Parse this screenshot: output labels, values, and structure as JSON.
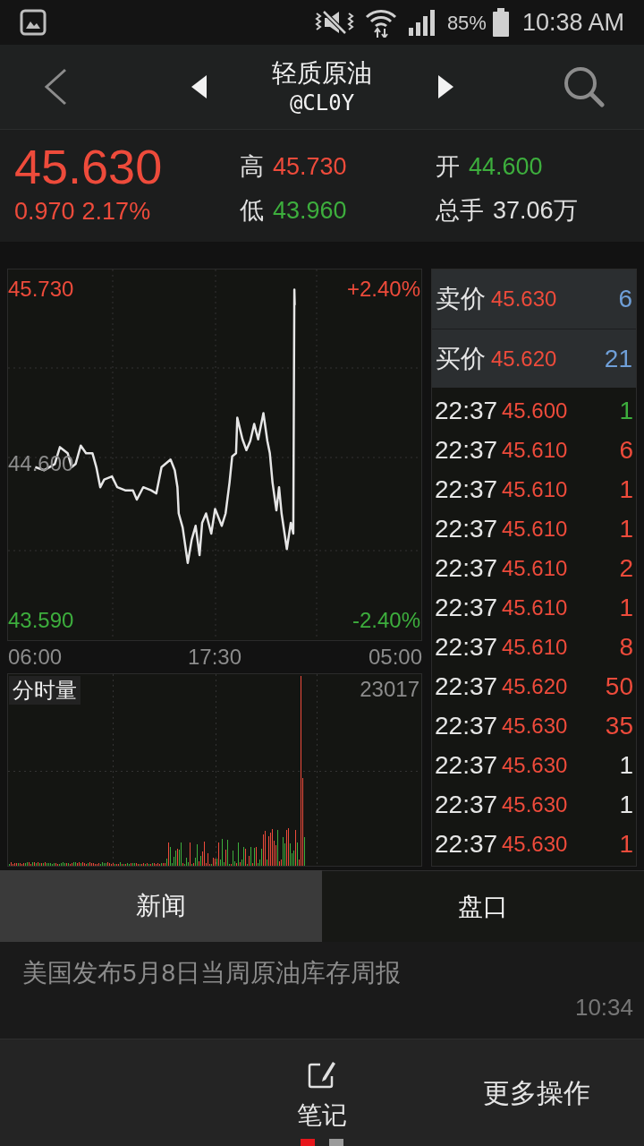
{
  "status_bar": {
    "battery": "85%",
    "time": "10:38 AM"
  },
  "header": {
    "title": "轻质原油",
    "symbol": "@CL0Y"
  },
  "quote": {
    "price": "45.630",
    "change": "0.970",
    "change_percent": "2.17%",
    "stats": [
      {
        "label": "高",
        "value": "45.730",
        "color": "#ee4b3b"
      },
      {
        "label": "开",
        "value": "44.600",
        "color": "#3dae3d"
      },
      {
        "label": "低",
        "value": "43.960",
        "color": "#3dae3d"
      },
      {
        "label": "总手",
        "value": "37.06万",
        "color": "#e0e0e0"
      }
    ]
  },
  "price_chart": {
    "range_labels": {
      "upper": "+2.40%",
      "lower": "-2.40%"
    },
    "session_end_label": "05:00",
    "chart_data": {
      "type": "line",
      "x": [
        6.02,
        6.6,
        7.27,
        7.6,
        8.1,
        8.35,
        8.6,
        8.93,
        9.27,
        9.68,
        9.93,
        10.18,
        10.43,
        10.93,
        11.27,
        11.77,
        12.27,
        12.52,
        12.93,
        13.43,
        13.77,
        14.1,
        14.68,
        14.95,
        15.12,
        15.2,
        15.45,
        15.78,
        16.03,
        16.28,
        16.53,
        16.7,
        16.95,
        17.28,
        17.53,
        17.95,
        18.2,
        18.45,
        18.62,
        18.87,
        18.95,
        19.28,
        19.53,
        19.78,
        20.03,
        20.28,
        20.62,
        20.87,
        21.03,
        21.2,
        21.45,
        21.62,
        21.78,
        22.12,
        22.37,
        22.53,
        22.6,
        22.62
      ],
      "series": [
        {
          "color": "#e6e6e6",
          "values": [
            44.58,
            44.56,
            44.6,
            44.71,
            44.67,
            44.58,
            44.6,
            44.72,
            44.67,
            44.67,
            44.58,
            44.45,
            44.5,
            44.52,
            44.45,
            44.43,
            44.43,
            44.37,
            44.45,
            44.43,
            44.41,
            44.58,
            44.63,
            44.56,
            44.45,
            44.28,
            44.19,
            43.96,
            44.11,
            44.2,
            44.01,
            44.22,
            44.28,
            44.15,
            44.31,
            44.2,
            44.28,
            44.48,
            44.65,
            44.67,
            44.9,
            44.76,
            44.69,
            44.75,
            44.86,
            44.76,
            44.93,
            44.75,
            44.67,
            44.48,
            44.3,
            44.45,
            44.28,
            44.05,
            44.22,
            44.15,
            45.73,
            45.63
          ]
        }
      ],
      "xlim": [
        4.28,
        30.72
      ],
      "ylim": [
        43.46,
        45.86
      ],
      "xticks": [
        {
          "value": 6,
          "label": "06:00"
        },
        {
          "value": 17.5,
          "label": "17:30"
        }
      ],
      "yticks": [
        {
          "value": 43.59,
          "label": "43.590"
        },
        {
          "value": 44.6,
          "label": "44.600"
        },
        {
          "value": 45.73,
          "label": "45.730"
        }
      ]
    }
  },
  "volume_chart": {
    "title": "分时量",
    "max_label": "23017"
  },
  "order_book": {
    "quotes": [
      {
        "label": "卖价",
        "price": "45.630",
        "size": "6"
      },
      {
        "label": "买价",
        "price": "45.620",
        "size": "21"
      }
    ],
    "trades": [
      {
        "time": "22:37",
        "price": "45.600",
        "volume": "1",
        "color": "#3dae3d"
      },
      {
        "time": "22:37",
        "price": "45.610",
        "volume": "6",
        "color": "#ee4b3b"
      },
      {
        "time": "22:37",
        "price": "45.610",
        "volume": "1",
        "color": "#ee4b3b"
      },
      {
        "time": "22:37",
        "price": "45.610",
        "volume": "1",
        "color": "#ee4b3b"
      },
      {
        "time": "22:37",
        "price": "45.610",
        "volume": "2",
        "color": "#ee4b3b"
      },
      {
        "time": "22:37",
        "price": "45.610",
        "volume": "1",
        "color": "#ee4b3b"
      },
      {
        "time": "22:37",
        "price": "45.610",
        "volume": "8",
        "color": "#ee4b3b"
      },
      {
        "time": "22:37",
        "price": "45.620",
        "volume": "50",
        "color": "#ee4b3b"
      },
      {
        "time": "22:37",
        "price": "45.630",
        "volume": "35",
        "color": "#ee4b3b"
      },
      {
        "time": "22:37",
        "price": "45.630",
        "volume": "1",
        "color": "#e6e6e6"
      },
      {
        "time": "22:37",
        "price": "45.630",
        "volume": "1",
        "color": "#e6e6e6"
      },
      {
        "time": "22:37",
        "price": "45.630",
        "volume": "1",
        "color": "#ee4b3b"
      }
    ]
  },
  "tabs": [
    {
      "label": "新闻",
      "selected": true
    },
    {
      "label": "盘口",
      "selected": false
    }
  ],
  "news": {
    "headline": "美国发布5月8日当周原油库存周报",
    "time": "10:34"
  },
  "bottom_bar": {
    "actions": [
      {
        "kind": "note",
        "label": "笔记"
      },
      {
        "kind": "more",
        "label": "更多操作"
      }
    ],
    "page_dots": [
      {
        "selected": true
      },
      {
        "selected": false
      }
    ]
  }
}
